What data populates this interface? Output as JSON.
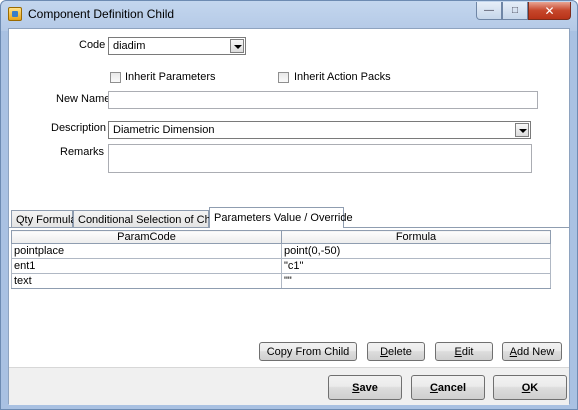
{
  "window": {
    "title": "Component Definition Child",
    "minimize_glyph": "—",
    "maximize_glyph": "□",
    "close_glyph": "✕"
  },
  "form": {
    "code_label": "Code",
    "code_value": "diadim",
    "inherit_parameters_label": "Inherit Parameters",
    "inherit_parameters_checked": false,
    "inherit_action_packs_label": "Inherit Action Packs",
    "inherit_action_packs_checked": false,
    "new_name_label": "New Name",
    "new_name_value": "",
    "description_label": "Description",
    "description_value": "Diametric Dimension",
    "remarks_label": "Remarks",
    "remarks_value": ""
  },
  "tabs": [
    {
      "label": "Qty Formula",
      "active": false
    },
    {
      "label": "Conditional Selection of Child",
      "active": false
    },
    {
      "label": "Parameters Value / Override",
      "active": true
    }
  ],
  "grid": {
    "columns": [
      "ParamCode",
      "Formula"
    ],
    "rows": [
      [
        "pointplace",
        "point(0,-50)"
      ],
      [
        "ent1",
        "\"c1\""
      ],
      [
        "text",
        "\"\""
      ]
    ]
  },
  "buttons": {
    "copy_from_child": "Copy From Child",
    "delete_first": "D",
    "delete_rest": "elete",
    "edit_first": "E",
    "edit_rest": "dit",
    "add_new_first": "A",
    "add_new_rest": "dd New",
    "save_first": "S",
    "save_rest": "ave",
    "cancel_first": "C",
    "cancel_rest": "ancel",
    "ok_first": "O",
    "ok_rest": "K"
  }
}
